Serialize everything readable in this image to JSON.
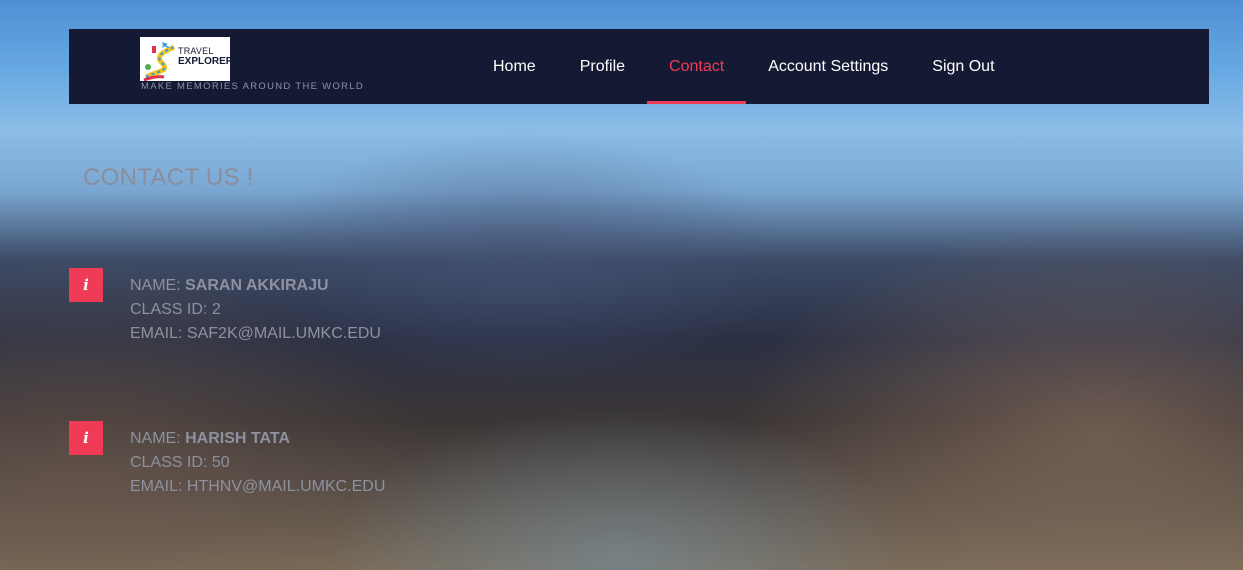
{
  "brand": {
    "logo_line1": "TRAVEL",
    "logo_line2": "EXPLORER",
    "tagline": "MAKE MEMORIES AROUND THE WORLD"
  },
  "nav": {
    "items": [
      {
        "label": "Home"
      },
      {
        "label": "Profile"
      },
      {
        "label": "Contact"
      },
      {
        "label": "Account Settings"
      },
      {
        "label": "Sign Out"
      }
    ],
    "active": "Contact"
  },
  "page": {
    "title": "CONTACT US !"
  },
  "contacts": [
    {
      "icon": "info-icon",
      "icon_glyph": "i",
      "name_label": "NAME:",
      "name": "SARAN AKKIRAJU",
      "class_label": "CLASS ID:",
      "class_id": "2",
      "email_label": "EMAIL:",
      "email": "SAF2K@MAIL.UMKC.EDU"
    },
    {
      "icon": "info-icon",
      "icon_glyph": "i",
      "name_label": "NAME:",
      "name": "HARISH TATA",
      "class_label": "CLASS ID:",
      "class_id": "50",
      "email_label": "EMAIL:",
      "email": "HTHNV@MAIL.UMKC.EDU"
    }
  ],
  "colors": {
    "navbar_bg": "#141a33",
    "accent": "#ef3b55",
    "nav_text": "#ffffff",
    "muted_text": "#8e919f"
  }
}
